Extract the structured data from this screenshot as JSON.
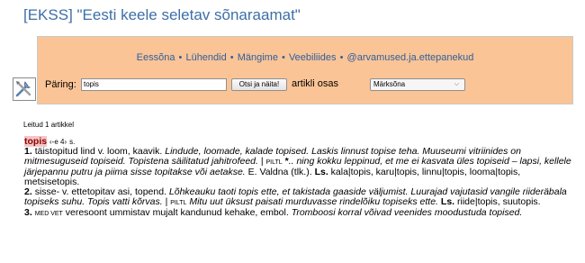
{
  "page_title": "[EKSS] \"Eesti keele seletav sõnaraamat\"",
  "nav": {
    "items": [
      "Eessõna",
      "Lühendid",
      "Mängime",
      "Veebiliides",
      "@arvamused.ja.ettepanekud"
    ],
    "separator": "•"
  },
  "search": {
    "label": "Päring:",
    "value": "topis",
    "button_label": "Otsi ja näita!",
    "mode_label": "artikli osas",
    "mode_value": "Märksõna"
  },
  "results": {
    "found_text": "Leitud 1 artikkel"
  },
  "entry": {
    "headword": "topis",
    "inflection": "‹-e 4›",
    "pos": "s.",
    "senses": [
      {
        "num": "1.",
        "parts": [
          {
            "t": "täistopitud lind v. loom, kaavik. "
          },
          {
            "t": "Lindude, loomade, kalade topised. Laskis linnust topise teha. Muuseumi vitriinides on mitmesuguseid topiseid. Topistena säilitatud jahitrofeed. ",
            "s": "i"
          },
          {
            "t": "| "
          },
          {
            "t": "PILTL",
            "s": "tag"
          },
          {
            "t": " *",
            "s": "b"
          },
          {
            "t": ".. ning kokku leppinud, et me ei kasvata üles topiseid – lapsi, kellele järjepannu putru ja piima sisse topitakse või aetakse. ",
            "s": "i"
          },
          {
            "t": "E. Valdna (tlk.). "
          },
          {
            "t": "Ls.",
            "s": "b"
          },
          {
            "t": " kala|topis, karu|topis, linnu|topis, looma|topis, metsisetopis."
          }
        ]
      },
      {
        "num": "2.",
        "parts": [
          {
            "t": "sisse- v. ettetopitav asi, topend. "
          },
          {
            "t": "Lõhkeauku taoti topis ette, et takistada gaaside väljumist. Luurajad vajutasid vangile riideräbala topiseks suhu. Topis vatti kõrvas. ",
            "s": "i"
          },
          {
            "t": "| "
          },
          {
            "t": "PILTL",
            "s": "tag"
          },
          {
            "t": " "
          },
          {
            "t": "Mitu uut üksust paisati murduvasse rindelõiku topiseks ette. ",
            "s": "i"
          },
          {
            "t": "Ls.",
            "s": "b"
          },
          {
            "t": " riide|topis, suutopis."
          }
        ]
      },
      {
        "num": "3.",
        "parts": [
          {
            "t": "MED VET",
            "s": "tag"
          },
          {
            "t": " veresoont ummistav mujalt kandunud kehake, embol. "
          },
          {
            "t": "Tromboosi korral võivad veenides moodustuda topised.",
            "s": "i"
          }
        ]
      }
    ]
  }
}
